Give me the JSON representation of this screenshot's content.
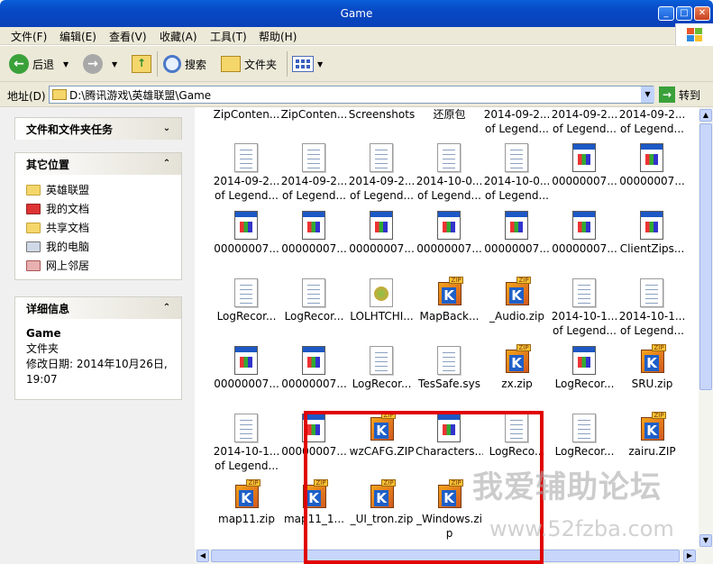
{
  "window": {
    "title": "Game"
  },
  "menu": [
    "文件(F)",
    "编辑(E)",
    "查看(V)",
    "收藏(A)",
    "工具(T)",
    "帮助(H)"
  ],
  "toolbar": {
    "back": "后退",
    "search": "搜索",
    "folders": "文件夹"
  },
  "address": {
    "label": "地址(D)",
    "value": "D:\\腾讯游戏\\英雄联盟\\Game",
    "go": "转到"
  },
  "left": {
    "tasks_title": "文件和文件夹任务",
    "other_title": "其它位置",
    "other_items": [
      {
        "label": "英雄联盟",
        "icon": "folder-icon"
      },
      {
        "label": "我的文档",
        "icon": "my-documents-icon"
      },
      {
        "label": "共享文档",
        "icon": "folder-icon"
      },
      {
        "label": "我的电脑",
        "icon": "my-computer-icon"
      },
      {
        "label": "网上邻居",
        "icon": "network-icon"
      }
    ],
    "details_title": "详细信息",
    "details_name": "Game",
    "details_type": "文件夹",
    "details_modified": "修改日期: 2014年10月26日, 19:07"
  },
  "files": [
    {
      "l1": "ZipConten...",
      "l2": "",
      "type": "none"
    },
    {
      "l1": "ZipConten...",
      "l2": "",
      "type": "none"
    },
    {
      "l1": "Screenshots",
      "l2": "",
      "type": "none"
    },
    {
      "l1": "还原包",
      "l2": "",
      "type": "none"
    },
    {
      "l1": "2014-09-2...",
      "l2": "of Legend...",
      "type": "none"
    },
    {
      "l1": "2014-09-2...",
      "l2": "of Legend...",
      "type": "none"
    },
    {
      "l1": "2014-09-2...",
      "l2": "of Legend...",
      "type": "none"
    },
    {
      "l1": "2014-09-2...",
      "l2": "of Legend...",
      "type": "doc"
    },
    {
      "l1": "2014-09-2...",
      "l2": "of Legend...",
      "type": "doc"
    },
    {
      "l1": "2014-09-2...",
      "l2": "of Legend...",
      "type": "doc"
    },
    {
      "l1": "2014-10-0...",
      "l2": "of Legend...",
      "type": "doc"
    },
    {
      "l1": "2014-10-0...",
      "l2": "of Legend...",
      "type": "doc"
    },
    {
      "l1": "00000007...",
      "l2": "",
      "type": "exe"
    },
    {
      "l1": "00000007...",
      "l2": "",
      "type": "exe"
    },
    {
      "l1": "00000007...",
      "l2": "",
      "type": "exe"
    },
    {
      "l1": "00000007...",
      "l2": "",
      "type": "exe"
    },
    {
      "l1": "00000007...",
      "l2": "",
      "type": "exe"
    },
    {
      "l1": "00000007...",
      "l2": "",
      "type": "exe"
    },
    {
      "l1": "00000007...",
      "l2": "",
      "type": "exe"
    },
    {
      "l1": "00000007...",
      "l2": "",
      "type": "exe"
    },
    {
      "l1": "ClientZips...",
      "l2": "",
      "type": "exe"
    },
    {
      "l1": "LogRecor...",
      "l2": "",
      "type": "doc"
    },
    {
      "l1": "LogRecor...",
      "l2": "",
      "type": "doc"
    },
    {
      "l1": "LOLHTCHI...",
      "l2": "",
      "type": "img"
    },
    {
      "l1": "MapBack...",
      "l2": "",
      "type": "zip"
    },
    {
      "l1": "_Audio.zip",
      "l2": "",
      "type": "zip"
    },
    {
      "l1": "2014-10-1...",
      "l2": "of Legend...",
      "type": "doc"
    },
    {
      "l1": "2014-10-1...",
      "l2": "of Legend...",
      "type": "doc"
    },
    {
      "l1": "00000007...",
      "l2": "",
      "type": "exe"
    },
    {
      "l1": "00000007...",
      "l2": "",
      "type": "exe"
    },
    {
      "l1": "LogRecor...",
      "l2": "",
      "type": "doc"
    },
    {
      "l1": "TesSafe.sys",
      "l2": "",
      "type": "doc"
    },
    {
      "l1": "zx.zip",
      "l2": "",
      "type": "zip"
    },
    {
      "l1": "LogRecor...",
      "l2": "",
      "type": "exe"
    },
    {
      "l1": "SRU.zip",
      "l2": "",
      "type": "zip"
    },
    {
      "l1": "2014-10-1...",
      "l2": "of Legend...",
      "type": "doc"
    },
    {
      "l1": "00000007...",
      "l2": "",
      "type": "exe"
    },
    {
      "l1": "wzCAFG.ZIP",
      "l2": "",
      "type": "zip"
    },
    {
      "l1": "Characters...",
      "l2": "",
      "type": "exe"
    },
    {
      "l1": "LogReco...",
      "l2": "",
      "type": "doc"
    },
    {
      "l1": "LogRecor...",
      "l2": "",
      "type": "doc"
    },
    {
      "l1": "zairu.ZIP",
      "l2": "",
      "type": "zip"
    },
    {
      "l1": "map11.zip",
      "l2": "",
      "type": "zip"
    },
    {
      "l1": "map11_1...",
      "l2": "",
      "type": "zip"
    },
    {
      "l1": "_UI_tron.zip",
      "l2": "",
      "type": "zip"
    },
    {
      "l1": "_Windows.zi",
      "l2": "p",
      "type": "zip"
    }
  ],
  "watermark": {
    "cn": "我爱辅助论坛",
    "url": "www.52fzba.com"
  }
}
